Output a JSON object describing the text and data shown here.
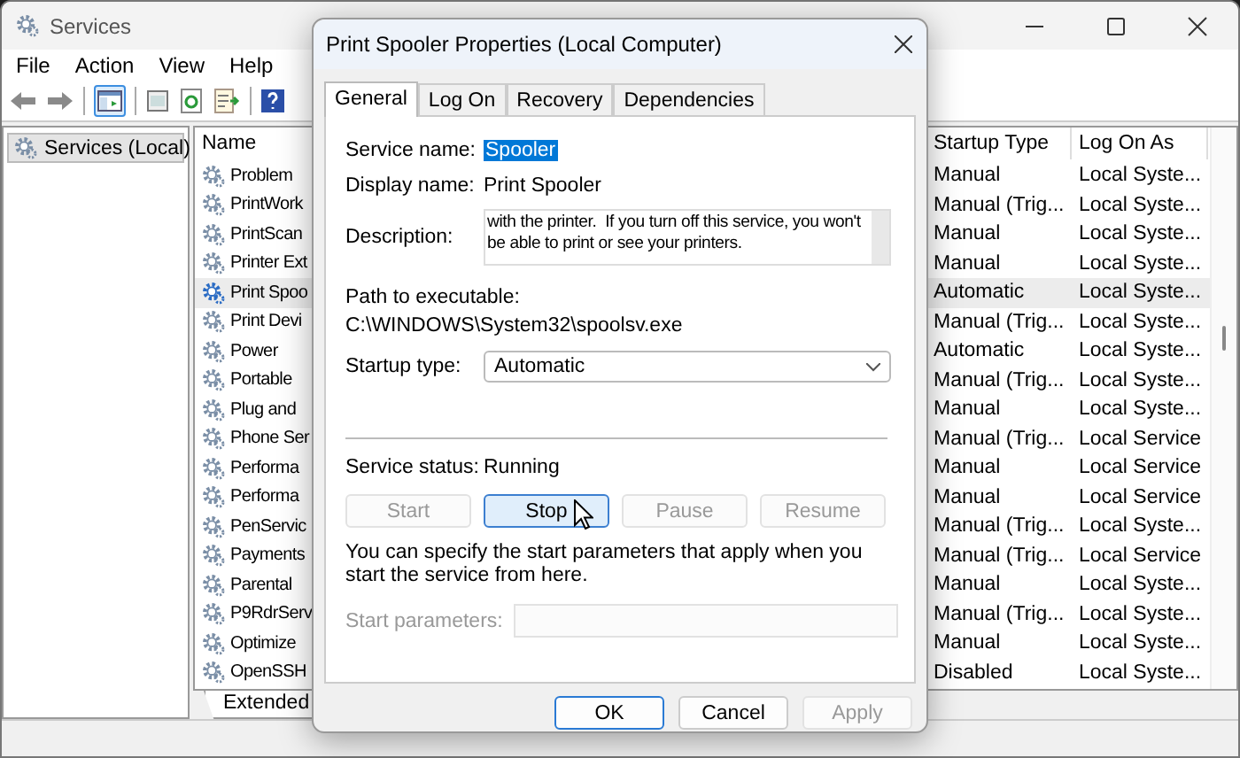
{
  "window": {
    "title": "Services"
  },
  "menu": [
    "File",
    "Action",
    "View",
    "Help"
  ],
  "toolbar": {
    "console_tree_on": true
  },
  "tree": [
    {
      "label": "Services (Local)",
      "selected": true
    }
  ],
  "services": {
    "columns": [
      "Name",
      "Startup Type",
      "Log On As"
    ],
    "rows": [
      {
        "name": "Problem",
        "startup_type": "Manual",
        "log_on_as": "Local Syste...",
        "selected": false
      },
      {
        "name": "PrintWork",
        "startup_type": "Manual (Trig...",
        "log_on_as": "Local Syste...",
        "selected": false
      },
      {
        "name": "PrintScan",
        "startup_type": "Manual",
        "log_on_as": "Local Syste...",
        "selected": false
      },
      {
        "name": "Printer Ext",
        "startup_type": "Manual",
        "log_on_as": "Local Syste...",
        "selected": false
      },
      {
        "name": "Print Spoo",
        "startup_type": "Automatic",
        "log_on_as": "Local Syste...",
        "selected": true
      },
      {
        "name": "Print Devi",
        "startup_type": "Manual (Trig...",
        "log_on_as": "Local Syste...",
        "selected": false
      },
      {
        "name": "Power",
        "startup_type": "Automatic",
        "log_on_as": "Local Syste...",
        "selected": false
      },
      {
        "name": "Portable",
        "startup_type": "Manual (Trig...",
        "log_on_as": "Local Syste...",
        "selected": false
      },
      {
        "name": "Plug and",
        "startup_type": "Manual",
        "log_on_as": "Local Syste...",
        "selected": false
      },
      {
        "name": "Phone Ser",
        "startup_type": "Manual (Trig...",
        "log_on_as": "Local Service",
        "selected": false
      },
      {
        "name": "Performa",
        "startup_type": "Manual",
        "log_on_as": "Local Service",
        "selected": false
      },
      {
        "name": "Performa",
        "startup_type": "Manual",
        "log_on_as": "Local Service",
        "selected": false
      },
      {
        "name": "PenServic",
        "startup_type": "Manual (Trig...",
        "log_on_as": "Local Syste...",
        "selected": false
      },
      {
        "name": "Payments",
        "startup_type": "Manual (Trig...",
        "log_on_as": "Local Service",
        "selected": false
      },
      {
        "name": "Parental",
        "startup_type": "Manual",
        "log_on_as": "Local Syste...",
        "selected": false
      },
      {
        "name": "P9RdrServ",
        "startup_type": "Manual (Trig...",
        "log_on_as": "Local Syste...",
        "selected": false
      },
      {
        "name": "Optimize",
        "startup_type": "Manual",
        "log_on_as": "Local Syste...",
        "selected": false
      },
      {
        "name": "OpenSSH",
        "startup_type": "Disabled",
        "log_on_as": "Local Syste...",
        "selected": false
      }
    ]
  },
  "view_tabs": [
    {
      "label": "Extended",
      "selected": true
    }
  ],
  "dialog": {
    "title": "Print Spooler Properties (Local Computer)",
    "tabs": [
      {
        "label": "General",
        "selected": true
      },
      {
        "label": "Log On",
        "selected": false
      },
      {
        "label": "Recovery",
        "selected": false
      },
      {
        "label": "Dependencies",
        "selected": false
      }
    ],
    "service_name": {
      "label": "Service name:",
      "value": "Spooler",
      "highlighted": true
    },
    "display_name": {
      "label": "Display name:",
      "value": "Print Spooler"
    },
    "description": {
      "label": "Description:",
      "value": "with the printer.  If you turn off this service, you won't be able to print or see your printers."
    },
    "path": {
      "label": "Path to executable:",
      "value": "C:\\WINDOWS\\System32\\spoolsv.exe"
    },
    "startup_type": {
      "label": "Startup type:",
      "value": "Automatic"
    },
    "service_status": {
      "label": "Service status:",
      "value": "Running"
    },
    "control_buttons": [
      {
        "label": "Start",
        "disabled": true,
        "hovered": false
      },
      {
        "label": "Stop",
        "disabled": false,
        "hovered": true
      },
      {
        "label": "Pause",
        "disabled": true,
        "hovered": false
      },
      {
        "label": "Resume",
        "disabled": true,
        "hovered": false
      }
    ],
    "hint": "You can specify the start parameters that apply when you start the service from here.",
    "start_parameters": {
      "label": "Start parameters:",
      "disabled": true
    },
    "buttons": [
      {
        "label": "OK",
        "default": true,
        "disabled": false
      },
      {
        "label": "Cancel",
        "default": false,
        "disabled": false
      },
      {
        "label": "Apply",
        "default": false,
        "disabled": true
      }
    ]
  }
}
